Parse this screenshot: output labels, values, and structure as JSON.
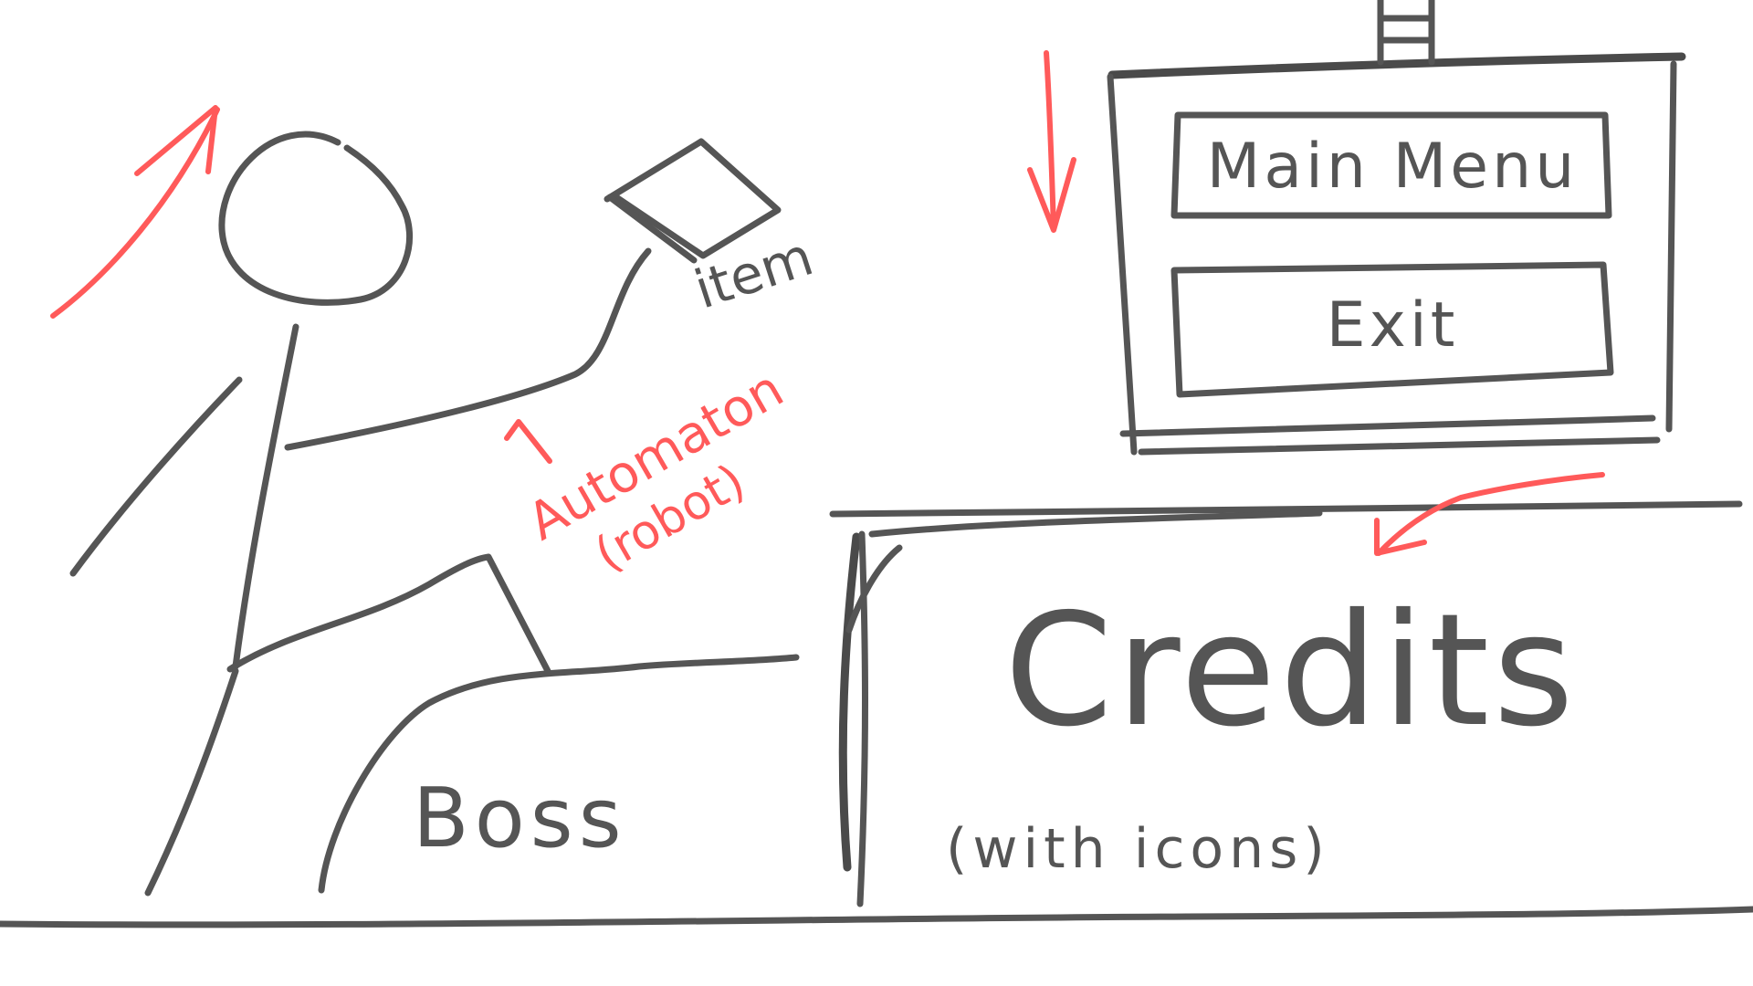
{
  "menu": {
    "main_menu_label": "Main Menu",
    "exit_label": "Exit"
  },
  "labels": {
    "item": "item",
    "automaton": "Automaton",
    "automaton_note": "(robot)",
    "boss": "Boss",
    "credits": "Credits",
    "credits_note": "(with icons)"
  },
  "colors": {
    "ink": "#555555",
    "annotation": "#ff5a5a",
    "background": "#ffffff"
  },
  "icons": [
    "stick-figure",
    "item-diamond-icon",
    "ladder-icon",
    "arrow-icon"
  ]
}
